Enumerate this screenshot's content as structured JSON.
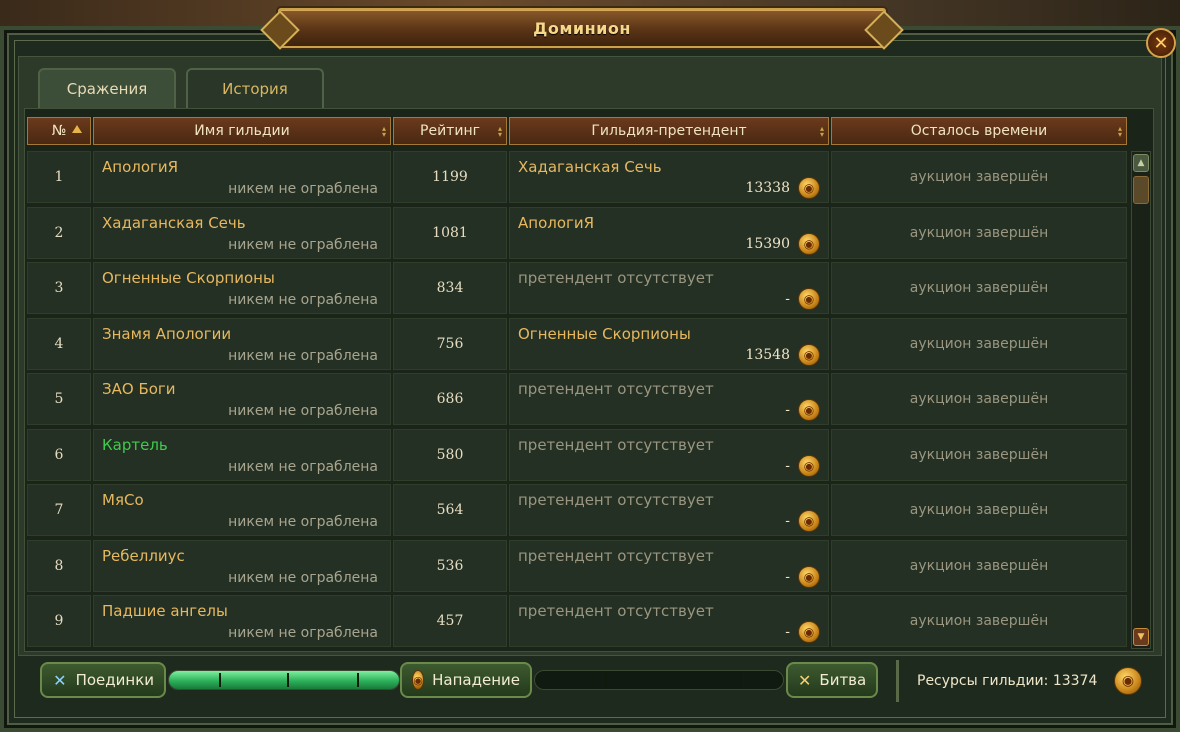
{
  "window": {
    "title": "Доминион",
    "close_icon": "close-icon"
  },
  "tabs": [
    {
      "label": "Сражения",
      "active": true
    },
    {
      "label": "История",
      "active": false
    }
  ],
  "table": {
    "headers": {
      "num": "№",
      "name": "Имя гильдии",
      "rating": "Рейтинг",
      "claimant": "Гильдия-претендент",
      "time": "Осталось времени"
    },
    "rows": [
      {
        "num": "1",
        "name": "АпологиЯ",
        "status": "никем не ограблена",
        "rating": "1199",
        "claimant": "Хадаганская Сечь",
        "bid": "13338",
        "time": "аукцион завершён"
      },
      {
        "num": "2",
        "name": "Хадаганская Сечь",
        "status": "никем не ограблена",
        "rating": "1081",
        "claimant": "АпологиЯ",
        "bid": "15390",
        "time": "аукцион завершён"
      },
      {
        "num": "3",
        "name": "Огненные Скорпионы",
        "status": "никем не ограблена",
        "rating": "834",
        "claimant": "претендент отсутствует",
        "bid": "-",
        "time": "аукцион завершён"
      },
      {
        "num": "4",
        "name": "Знамя Апологии",
        "status": "никем не ограблена",
        "rating": "756",
        "claimant": "Огненные Скорпионы",
        "bid": "13548",
        "time": "аукцион завершён"
      },
      {
        "num": "5",
        "name": "ЗАО Боги",
        "status": "никем не ограблена",
        "rating": "686",
        "claimant": "претендент отсутствует",
        "bid": "-",
        "time": "аукцион завершён"
      },
      {
        "num": "6",
        "name": "Картель",
        "status": "никем не ограблена",
        "rating": "580",
        "claimant": "претендент отсутствует",
        "bid": "-",
        "time": "аукцион завершён",
        "highlight": "#3fcc4c"
      },
      {
        "num": "7",
        "name": "МяСо",
        "status": "никем не ограблена",
        "rating": "564",
        "claimant": "претендент отсутствует",
        "bid": "-",
        "time": "аукцион завершён"
      },
      {
        "num": "8",
        "name": "Ребеллиус",
        "status": "никем не ограблена",
        "rating": "536",
        "claimant": "претендент отсутствует",
        "bid": "-",
        "time": "аукцион завершён"
      },
      {
        "num": "9",
        "name": "Падшие ангелы",
        "status": "никем не ограблена",
        "rating": "457",
        "claimant": "претендент отсутствует",
        "bid": "-",
        "time": "аукцион завершён"
      }
    ]
  },
  "bottom": {
    "duels_label": "Поединки",
    "attack_label": "Нападение",
    "battle_label": "Битва",
    "resources_label": "Ресурсы гильдии: 13374",
    "progress_duels": 1.0,
    "progress_battle": 0.0
  },
  "colors": {
    "accent_gold": "#e7b85e",
    "highlight_green": "#3fcc4c",
    "header_brown": "#6a3a1c"
  }
}
